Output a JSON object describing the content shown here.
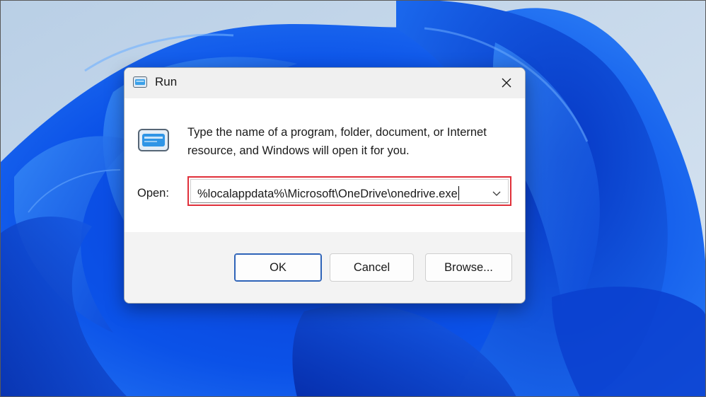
{
  "dialog": {
    "title": "Run",
    "description": "Type the name of a program, folder, document, or Internet resource, and Windows will open it for you.",
    "open_label": "Open:",
    "open_value": "%localappdata%\\Microsoft\\OneDrive\\onedrive.exe",
    "buttons": {
      "ok": "OK",
      "cancel": "Cancel",
      "browse": "Browse..."
    }
  },
  "icons": {
    "title": "run-icon",
    "close": "close-icon",
    "main": "run-icon",
    "dropdown": "chevron-down-icon"
  },
  "colors": {
    "highlight_border": "#e0303a",
    "dialog_background": "#f3f3f3",
    "content_background": "#ffffff",
    "ok_button_border": "#2e63b8"
  }
}
